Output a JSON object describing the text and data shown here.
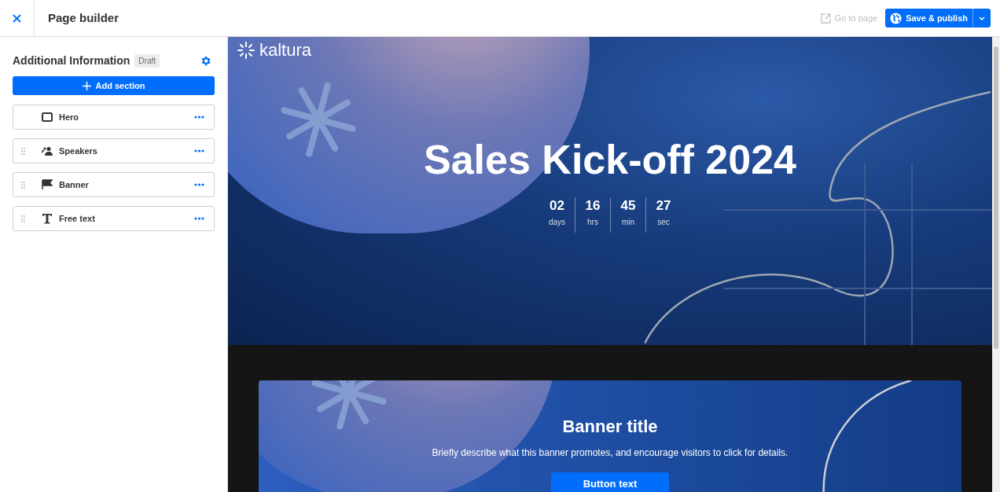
{
  "header": {
    "title": "Page builder",
    "go_to_page": {
      "label": "Go to page",
      "disabled": true
    },
    "publish_button": "Save & publish"
  },
  "sidebar": {
    "page_name": "Additional Information",
    "status_badge": "Draft",
    "add_button": "Add section",
    "sections": [
      {
        "label": "Hero",
        "kind": "hero",
        "draggable": false
      },
      {
        "label": "Speakers",
        "kind": "speakers",
        "draggable": true
      },
      {
        "label": "Banner",
        "kind": "banner",
        "draggable": true
      },
      {
        "label": "Free text",
        "kind": "text",
        "draggable": true
      }
    ]
  },
  "preview": {
    "logo": "kaltura",
    "hero_title": "Sales Kick-off 2024",
    "countdown": [
      {
        "value": "02",
        "unit": "days"
      },
      {
        "value": "16",
        "unit": "hrs"
      },
      {
        "value": "45",
        "unit": "min"
      },
      {
        "value": "27",
        "unit": "sec"
      }
    ],
    "banner": {
      "title": "Banner title",
      "description": "Briefly describe what this banner promotes, and encourage visitors to click for details.",
      "button": "Button text"
    }
  }
}
